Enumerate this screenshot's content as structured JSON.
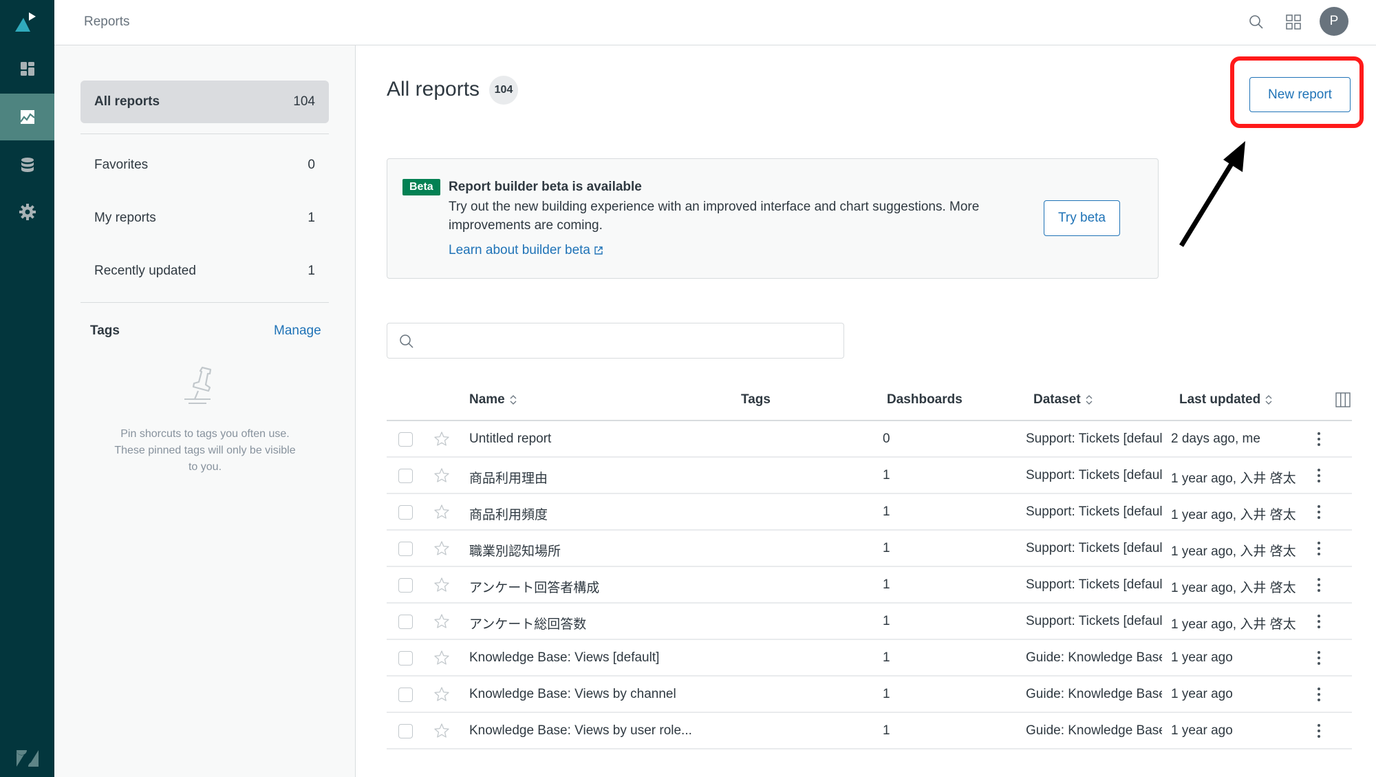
{
  "header": {
    "title": "Reports",
    "avatar_initial": "P"
  },
  "rail": {
    "items": [
      {
        "icon": "dashboard-icon"
      },
      {
        "icon": "reports-chart-icon",
        "active": true
      },
      {
        "icon": "datasets-database-icon"
      },
      {
        "icon": "settings-gear-icon"
      }
    ]
  },
  "subnav": {
    "items": [
      {
        "label": "All reports",
        "count": "104",
        "active": true
      },
      {
        "label": "Favorites",
        "count": "0"
      },
      {
        "label": "My reports",
        "count": "1"
      },
      {
        "label": "Recently updated",
        "count": "1"
      }
    ],
    "tags_label": "Tags",
    "manage_label": "Manage",
    "empty_text": "Pin shorcuts to tags you often use. These pinned tags will only be visible to you."
  },
  "main": {
    "title": "All reports",
    "count": "104",
    "new_report_label": "New report",
    "beta": {
      "badge": "Beta",
      "title": "Report builder beta is available",
      "description": "Try out the new building experience with an improved interface and chart suggestions. More improvements are coming.",
      "link": "Learn about builder beta",
      "button": "Try beta"
    },
    "search": {
      "value": "",
      "placeholder": ""
    },
    "table": {
      "columns": {
        "name": "Name",
        "tags": "Tags",
        "dashboards": "Dashboards",
        "dataset": "Dataset",
        "last_updated": "Last updated"
      },
      "rows": [
        {
          "name": "Untitled report",
          "tags": "",
          "dashboards": "0",
          "dataset": "Support: Tickets [default]",
          "last_updated": "2 days ago, me"
        },
        {
          "name": "商品利用理由",
          "tags": "",
          "dashboards": "1",
          "dataset": "Support: Tickets [default]",
          "last_updated": "1 year ago, 入井 啓太"
        },
        {
          "name": "商品利用頻度",
          "tags": "",
          "dashboards": "1",
          "dataset": "Support: Tickets [default]",
          "last_updated": "1 year ago, 入井 啓太"
        },
        {
          "name": "職業別認知場所",
          "tags": "",
          "dashboards": "1",
          "dataset": "Support: Tickets [default]",
          "last_updated": "1 year ago, 入井 啓太"
        },
        {
          "name": "アンケート回答者構成",
          "tags": "",
          "dashboards": "1",
          "dataset": "Support: Tickets [default]",
          "last_updated": "1 year ago, 入井 啓太"
        },
        {
          "name": "アンケート総回答数",
          "tags": "",
          "dashboards": "1",
          "dataset": "Support: Tickets [default]",
          "last_updated": "1 year ago, 入井 啓太"
        },
        {
          "name": "Knowledge Base: Views [default]",
          "tags": "",
          "dashboards": "1",
          "dataset": "Guide: Knowledge Base",
          "last_updated": "1 year ago"
        },
        {
          "name": "Knowledge Base: Views by channel",
          "tags": "",
          "dashboards": "1",
          "dataset": "Guide: Knowledge Base",
          "last_updated": "1 year ago"
        },
        {
          "name": "Knowledge Base: Views by user role...",
          "tags": "",
          "dashboards": "1",
          "dataset": "Guide: Knowledge Base",
          "last_updated": "1 year ago"
        }
      ]
    }
  },
  "annotation": {
    "highlight_color": "#ff1a1a",
    "arrow_color": "#000000"
  },
  "colors": {
    "rail_bg": "#03363d",
    "rail_active": "#4e8480",
    "accent_blue": "#1f73b7",
    "beta_green": "#038153"
  }
}
